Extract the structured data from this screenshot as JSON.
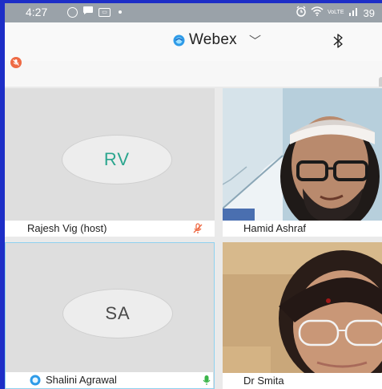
{
  "status_bar": {
    "time": "4:27",
    "battery": "39",
    "icons": [
      "whatsapp-icon",
      "chat-icon",
      "media-icon",
      "dot-icon",
      "alarm-icon",
      "wifi-icon",
      "volte-icon",
      "signal-icon"
    ],
    "volte_text": "VoLTE"
  },
  "header": {
    "title": "Webex",
    "chevron": "﹀",
    "bluetooth_glyph": "bluetooth-icon"
  },
  "participants": [
    {
      "name": "Rajesh Vig (host)",
      "initials": "RV",
      "muted": true,
      "video": false
    },
    {
      "name": "Hamid Ashraf",
      "video": true
    },
    {
      "name": "Shalini Agrawal",
      "initials": "SA",
      "active_speaker": true,
      "video": false
    },
    {
      "name": "Dr Smita",
      "video": true
    }
  ],
  "colors": {
    "frame": "#1d2ec7",
    "status_bar": "#9aa2a9",
    "initials_rv": "#2aa58e",
    "mute_red": "#ee6a44",
    "active_border": "#8fd1ef",
    "mic_green": "#3bb54a"
  }
}
